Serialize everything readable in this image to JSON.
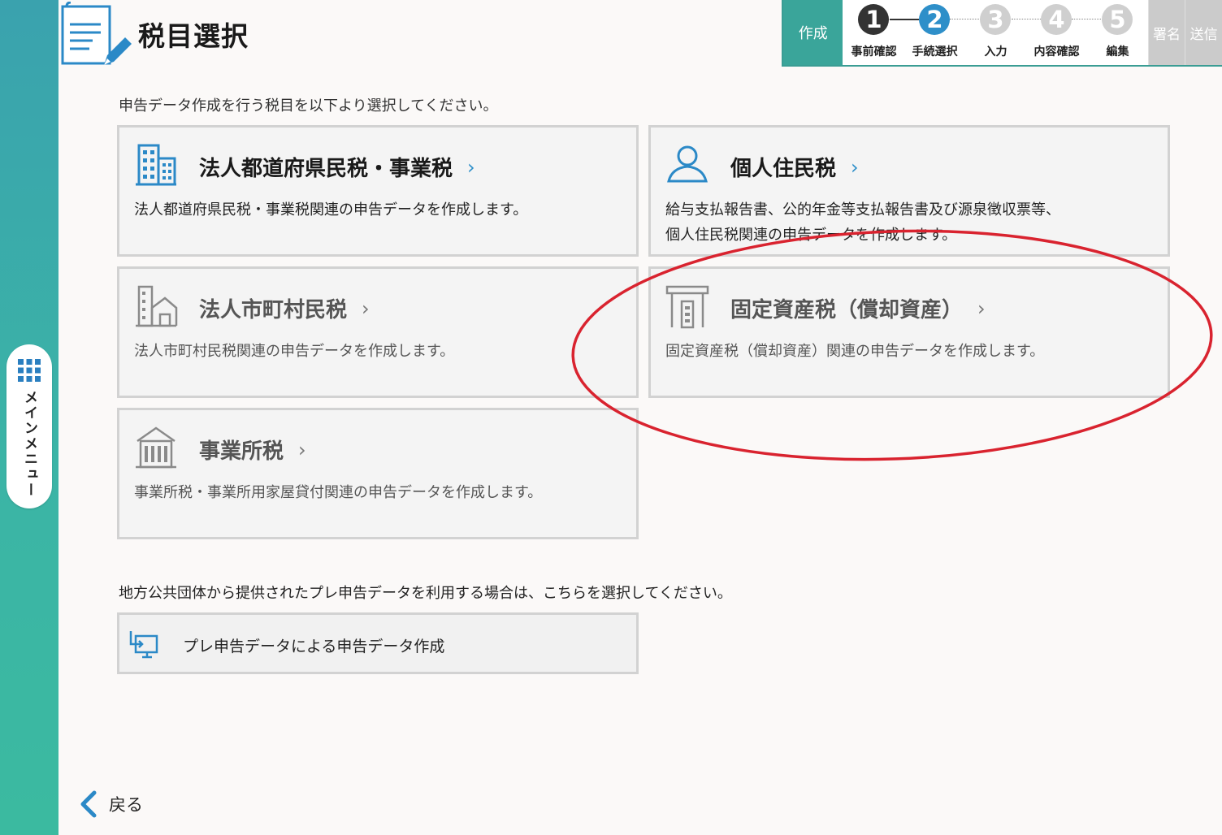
{
  "sidebar": {
    "menu_label": "メインメニュー",
    "menu_icon": "grid-icon",
    "accent_color": "#3aa9a8"
  },
  "header": {
    "page_title": "税目選択",
    "title_icon": "document-edit-icon"
  },
  "stepper": {
    "create_label": "作成",
    "steps": [
      {
        "number": "1",
        "label": "事前確認",
        "state": "done"
      },
      {
        "number": "2",
        "label": "手続選択",
        "state": "current"
      },
      {
        "number": "3",
        "label": "入力",
        "state": "future"
      },
      {
        "number": "4",
        "label": "内容確認",
        "state": "future"
      },
      {
        "number": "5",
        "label": "編集",
        "state": "future"
      }
    ],
    "sign_label": "署名",
    "send_label": "送信"
  },
  "main": {
    "instruction": "申告データ作成を行う税目を以下より選択してください。",
    "cards": [
      {
        "title": "法人都道府県民税・事業税",
        "description": "法人都道府県民税・事業税関連の申告データを作成します。",
        "icon": "office-building-icon",
        "enabled": true
      },
      {
        "title": "個人住民税",
        "description_lines": [
          "給与支払報告書、公的年金等支払報告書及び源泉徴収票等、",
          "個人住民税関連の申告データを作成します。"
        ],
        "icon": "person-icon",
        "enabled": true
      },
      {
        "title": "法人市町村民税",
        "description": "法人市町村民税関連の申告データを作成します。",
        "icon": "building-house-icon",
        "enabled": false
      },
      {
        "title": "固定資産税（償却資産）",
        "description": "固定資産税（償却資産）関連の申告データを作成します。",
        "icon": "shop-icon",
        "enabled": false
      },
      {
        "title": "事業所税",
        "description": "事業所税・事業所用家屋貸付関連の申告データを作成します。",
        "icon": "office-icon",
        "enabled": false
      }
    ],
    "chevron": "›",
    "pre_instruction": "地方公共団体から提供されたプレ申告データを利用する場合は、こちらを選択してください。",
    "pre_button_label": "プレ申告データによる申告データ作成",
    "pre_button_icon": "monitor-import-icon"
  },
  "footer": {
    "back_label": "戻る"
  },
  "annotation": {
    "color": "#d9232f"
  }
}
